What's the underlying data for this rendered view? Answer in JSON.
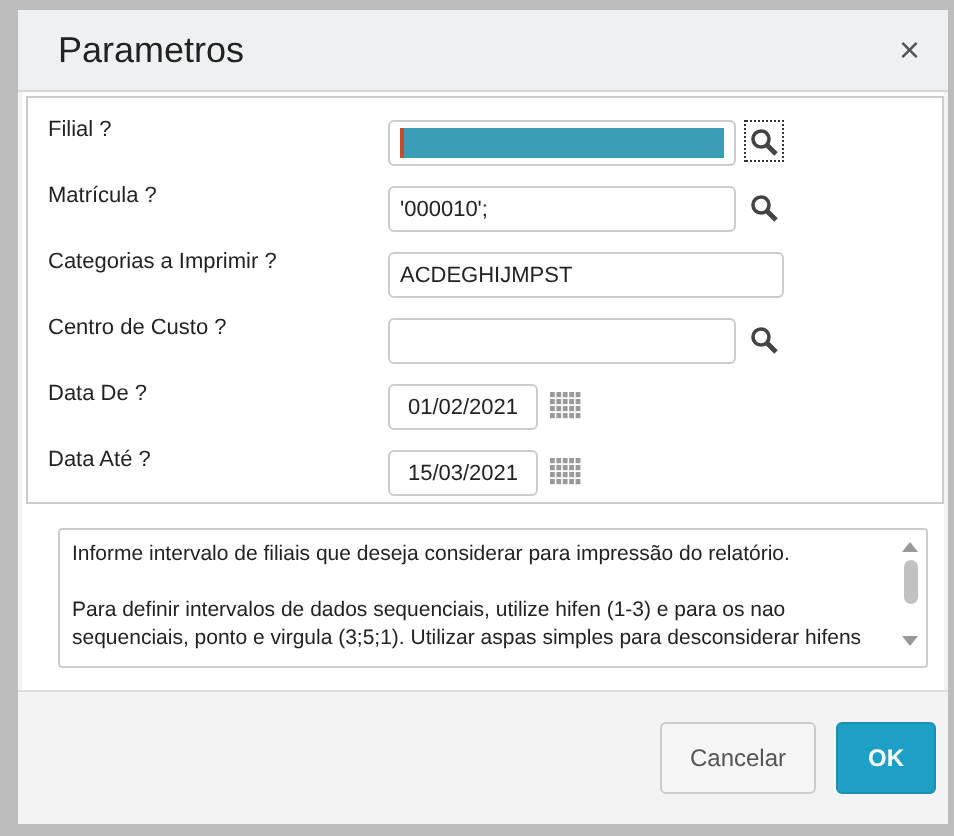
{
  "dialog": {
    "title": "Parametros",
    "close": "×"
  },
  "fields": [
    {
      "label": "Filial ?",
      "kind": "lookup",
      "selected": true,
      "button_focused": true
    },
    {
      "label": "Matrícula ?",
      "kind": "lookup",
      "value": "'000010';",
      "selected": false,
      "button_focused": false
    },
    {
      "label": "Categorias a Imprimir ?",
      "kind": "text",
      "value": "ACDEGHIJMPST",
      "selected": false
    },
    {
      "label": "Centro de Custo ?",
      "kind": "lookup",
      "selected": false,
      "button_focused": false
    },
    {
      "label": "Data De ?",
      "kind": "date",
      "value": "01/02/2021",
      "selected": false
    },
    {
      "label": "Data Até ?",
      "kind": "date",
      "value": "15/03/2021",
      "selected": false
    }
  ],
  "help": [
    "Informe intervalo de filiais que deseja considerar para impressão do relatório.",
    "Para definir intervalos de dados sequenciais, utilize hifen (1-3) e para os nao sequenciais, ponto e virgula (3;5;1). Utilizar aspas simples para desconsiderar hifens"
  ],
  "buttons": [
    {
      "label": "Cancelar",
      "kind": "secondary"
    },
    {
      "label": "OK",
      "kind": "primary"
    }
  ]
}
